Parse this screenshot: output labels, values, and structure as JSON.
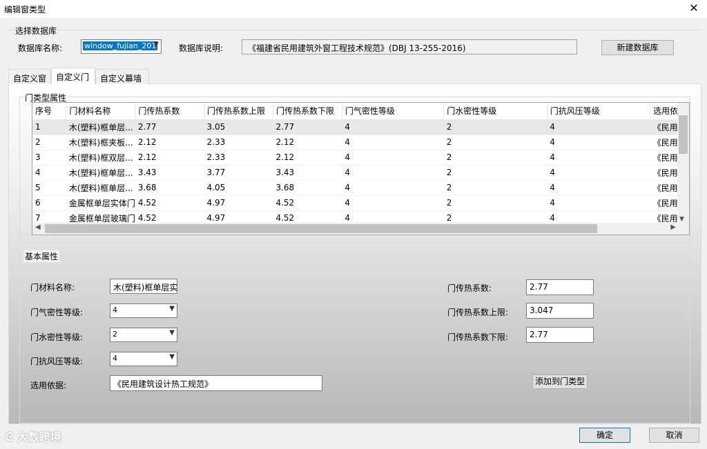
{
  "window": {
    "title": "编辑窗类型",
    "close_glyph": "✕"
  },
  "database": {
    "group_label": "选择数据库",
    "name_label": "数据库名称:",
    "name_value": "window_fujian_201",
    "desc_label": "数据库说明:",
    "desc_value": "《福建省民用建筑外窗工程技术规范》(DBJ 13-255-2016)",
    "new_button": "新建数据库"
  },
  "tabs": [
    {
      "label": "自定义窗",
      "active": false
    },
    {
      "label": "自定义门",
      "active": true
    },
    {
      "label": "自定义幕墙",
      "active": false
    }
  ],
  "door_types": {
    "group_label": "门类型属性",
    "columns": [
      "序号",
      "门材料名称",
      "门传热系数",
      "门传热系数上限",
      "门传热系数下限",
      "门气密性等级",
      "门水密性等级",
      "门抗风压等级",
      "选用依"
    ],
    "rows": [
      [
        "1",
        "木(塑料)框单层...",
        "2.77",
        "3.05",
        "2.77",
        "4",
        "2",
        "4",
        "《民用"
      ],
      [
        "2",
        "木(塑料)框夹板...",
        "2.12",
        "2.33",
        "2.12",
        "4",
        "2",
        "4",
        "《民用"
      ],
      [
        "3",
        "木(塑料)框双层...",
        "2.12",
        "2.33",
        "2.12",
        "4",
        "2",
        "4",
        "《民用"
      ],
      [
        "4",
        "木(塑料)框单层...",
        "3.43",
        "3.77",
        "3.43",
        "4",
        "2",
        "4",
        "《民用"
      ],
      [
        "5",
        "木(塑料)框单层...",
        "3.68",
        "4.05",
        "3.68",
        "4",
        "2",
        "4",
        "《民用"
      ],
      [
        "6",
        "金属框单层实体门",
        "4.52",
        "4.97",
        "4.52",
        "4",
        "2",
        "4",
        "《民用"
      ],
      [
        "7",
        "金属框单层玻璃门",
        "4.52",
        "4.97",
        "4.52",
        "4",
        "2",
        "4",
        "《民用"
      ]
    ]
  },
  "basic": {
    "group_label": "基本属性",
    "material_label": "门材料名称:",
    "material_value": "木(塑料)框单层实",
    "air_label": "门气密性等级:",
    "air_value": "4",
    "water_label": "门水密性等级:",
    "water_value": "2",
    "wind_label": "门抗风压等级:",
    "wind_value": "4",
    "basis_label": "选用依据:",
    "basis_value": "《民用建筑设计热工规范》",
    "u_label": "门传热系数:",
    "u_value": "2.77",
    "u_max_label": "门传热系数上限:",
    "u_max_value": "3.047",
    "u_min_label": "门传热系数下限:",
    "u_min_value": "2.77",
    "add_button": "添加到门类型"
  },
  "footer": {
    "ok": "确定",
    "cancel": "取消"
  },
  "watermark": "大数跨境"
}
